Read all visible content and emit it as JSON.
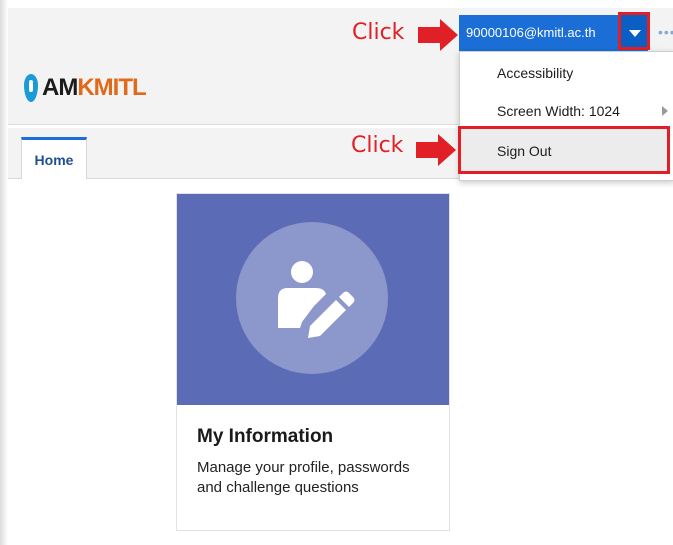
{
  "header": {
    "logo_text_a": "AM",
    "logo_text_b": "KMITL",
    "user_email": "90000106@kmitl.ac.th",
    "overflow": "•••"
  },
  "annotations": {
    "click_top": "Click",
    "click_bottom": "Click"
  },
  "user_menu": {
    "items": [
      {
        "label": "Accessibility"
      },
      {
        "label": "Screen Width: 1024"
      },
      {
        "label": "Sign Out"
      }
    ]
  },
  "tabs": [
    {
      "label": "Home",
      "active": true
    }
  ],
  "card": {
    "title": "My Information",
    "description": "Manage your profile, passwords and challenge questions"
  },
  "colors": {
    "accent": "#1a6ed6",
    "annotation_red": "#e11f26",
    "card_hero": "#5b6bb5",
    "logo_orange": "#e06a19"
  }
}
